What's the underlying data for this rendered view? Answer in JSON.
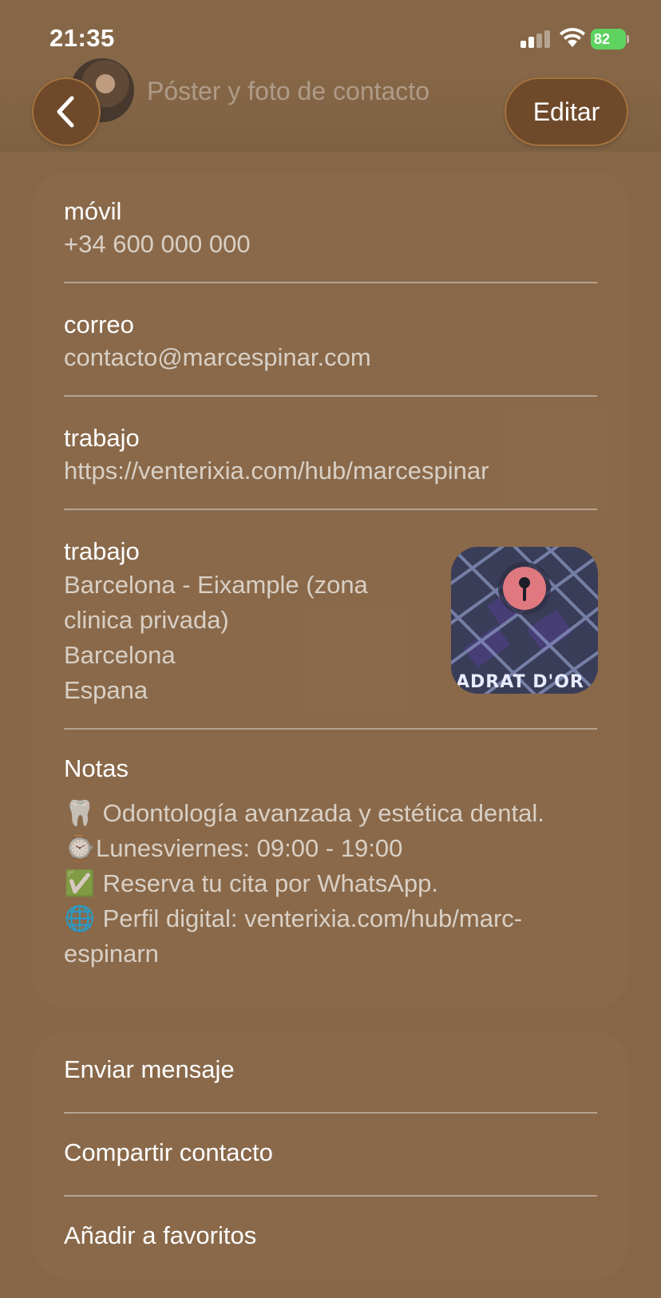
{
  "status": {
    "time": "21:35",
    "battery": "82"
  },
  "header": {
    "poster_title": "Póster y foto de contacto",
    "edit_label": "Editar"
  },
  "fields": {
    "mobile": {
      "label": "móvil",
      "value": "+34 600 000 000"
    },
    "email": {
      "label": "correo",
      "value": "contacto@marcespinar.com"
    },
    "work_url": {
      "label": "trabajo",
      "value": "https://venterixia.com/hub/marcespinar"
    },
    "work_address": {
      "label": "trabajo",
      "lines": [
        "Barcelona - Eixample (zona",
        "clinica privada)",
        "Barcelona",
        "Espana"
      ],
      "map_label": "ADRAT D'OR"
    }
  },
  "notes": {
    "label": "Notas",
    "lines": [
      {
        "emoji": "🦷",
        "text": " Odontología avanzada y estética dental."
      },
      {
        "emoji": "⌚",
        "text": "Lunesviernes: 09:00 - 19:00"
      },
      {
        "emoji": "✅",
        "text": " Reserva tu cita por WhatsApp."
      },
      {
        "emoji": "🌐",
        "text": " Perfil digital: venterixia.com/hub/marc-"
      },
      {
        "emoji": "",
        "text": "espinarn"
      }
    ]
  },
  "actions": {
    "send_message": "Enviar mensaje",
    "share_contact": "Compartir contacto",
    "add_favorite": "Añadir a favoritos"
  },
  "colors": {
    "background": "#856748",
    "button": "#6e4a2a",
    "battery": "#5fd35f",
    "pin": "#e07880"
  }
}
